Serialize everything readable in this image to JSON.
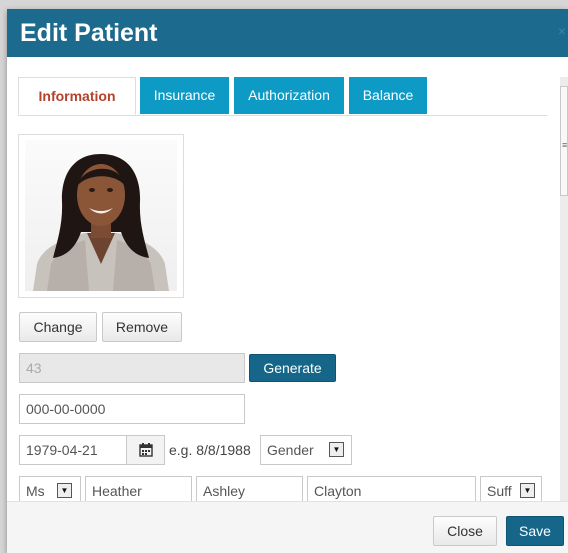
{
  "modal": {
    "title": "Edit Patient",
    "close_glyph": "×"
  },
  "tabs": [
    {
      "label": "Information",
      "active": true
    },
    {
      "label": "Insurance",
      "active": false
    },
    {
      "label": "Authorization",
      "active": false
    },
    {
      "label": "Balance",
      "active": false
    }
  ],
  "photo": {
    "change_label": "Change",
    "remove_label": "Remove"
  },
  "patient_id": {
    "value": "43",
    "generate_label": "Generate"
  },
  "ssn": {
    "value": "000-00-0000"
  },
  "dob": {
    "value": "1979-04-21",
    "hint": "e.g. 8/8/1988"
  },
  "gender": {
    "value": "Gender"
  },
  "name": {
    "prefix": "Ms",
    "first": "Heather",
    "middle": "Ashley",
    "last": "Clayton",
    "suffix": "Suff"
  },
  "footer": {
    "close_label": "Close",
    "save_label": "Save"
  },
  "colors": {
    "header": "#1c6a8e",
    "tab_inactive": "#0d9ac5",
    "tab_active_text": "#b5412a",
    "primary_button": "#156689"
  },
  "icons": [
    "calendar-icon",
    "dropdown-arrow-icon",
    "close-icon"
  ]
}
